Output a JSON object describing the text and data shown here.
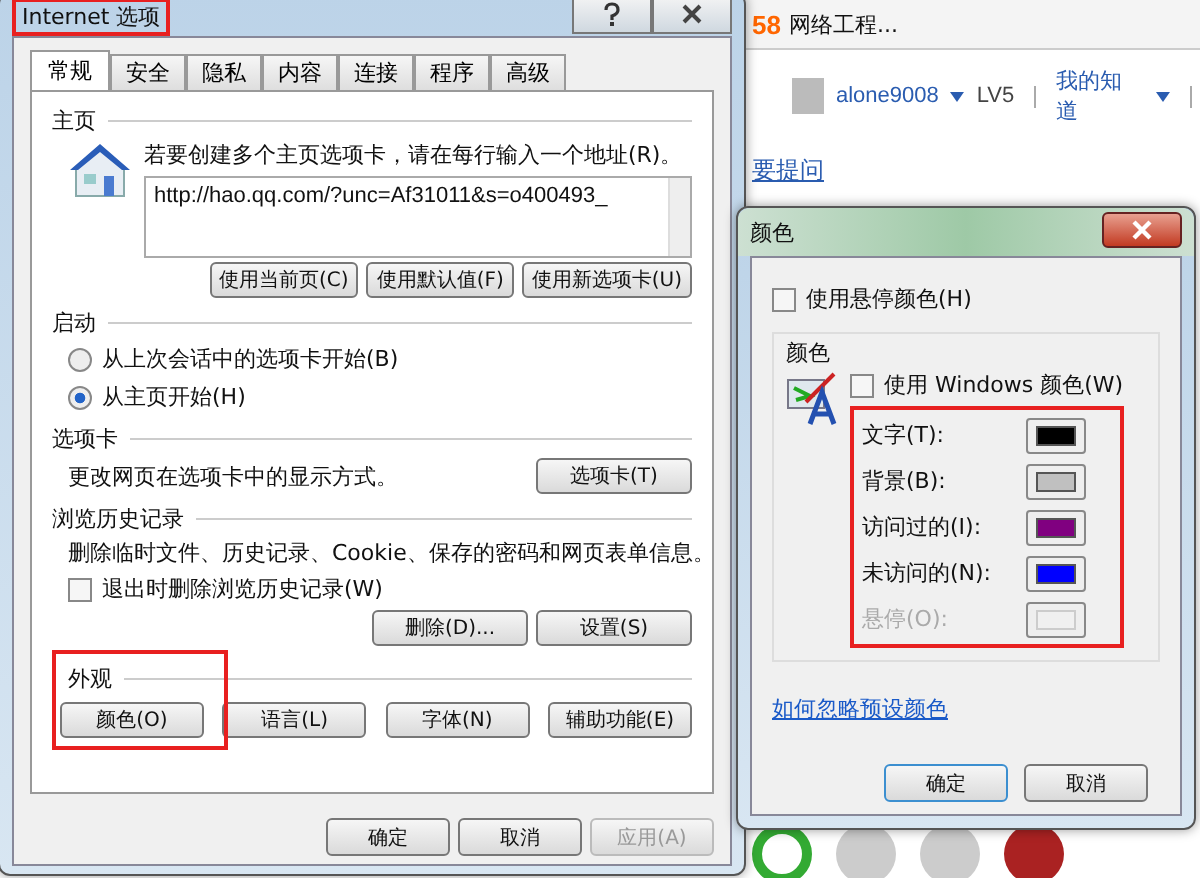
{
  "background_page": {
    "site_badge": "58",
    "site_title": "网络工程...",
    "username": "alone9008",
    "level": "LV5",
    "menu": "我的知道",
    "link": "要提问"
  },
  "internet_options": {
    "title": "Internet 选项",
    "tabs": [
      {
        "label": "常规",
        "selected": true
      },
      {
        "label": "安全",
        "selected": false
      },
      {
        "label": "隐私",
        "selected": false
      },
      {
        "label": "内容",
        "selected": false
      },
      {
        "label": "连接",
        "selected": false
      },
      {
        "label": "程序",
        "selected": false
      },
      {
        "label": "高级",
        "selected": false
      }
    ],
    "home_page": {
      "heading": "主页",
      "instruction": "若要创建多个主页选项卡，请在每行输入一个地址(R)。",
      "url": "http://hao.qq.com/?unc=Af31011&s=o400493_",
      "buttons": [
        "使用当前页(C)",
        "使用默认值(F)",
        "使用新选项卡(U)"
      ]
    },
    "startup": {
      "heading": "启动",
      "options": [
        {
          "label": "从上次会话中的选项卡开始(B)",
          "selected": false
        },
        {
          "label": "从主页开始(H)",
          "selected": true
        }
      ]
    },
    "tabs_section": {
      "heading": "选项卡",
      "description": "更改网页在选项卡中的显示方式。",
      "button": "选项卡(T)"
    },
    "history": {
      "heading": "浏览历史记录",
      "description": "删除临时文件、历史记录、Cookie、保存的密码和网页表单信息。",
      "checkbox": {
        "label": "退出时删除浏览历史记录(W)",
        "checked": false
      },
      "buttons": [
        "删除(D)...",
        "设置(S)"
      ]
    },
    "appearance": {
      "heading": "外观",
      "buttons": [
        "颜色(O)",
        "语言(L)",
        "字体(N)",
        "辅助功能(E)"
      ]
    },
    "footer_buttons": [
      {
        "label": "确定",
        "disabled": false
      },
      {
        "label": "取消",
        "disabled": false
      },
      {
        "label": "应用(A)",
        "disabled": true
      }
    ]
  },
  "colors_dialog": {
    "title": "颜色",
    "hover_checkbox": {
      "label": "使用悬停颜色(H)",
      "checked": false
    },
    "group_heading": "颜色",
    "windows_checkbox": {
      "label": "使用 Windows 颜色(W)",
      "checked": false
    },
    "swatches": [
      {
        "label": "文字(T):",
        "color": "#000000",
        "disabled": false
      },
      {
        "label": "背景(B):",
        "color": "#c0c0c0",
        "disabled": false
      },
      {
        "label": "访问过的(I):",
        "color": "#800080",
        "disabled": false
      },
      {
        "label": "未访问的(N):",
        "color": "#0000ff",
        "disabled": false
      },
      {
        "label": "悬停(O):",
        "color": "#f0f0f0",
        "disabled": true
      }
    ],
    "link": "如何忽略预设颜色",
    "buttons": [
      "确定",
      "取消"
    ]
  }
}
